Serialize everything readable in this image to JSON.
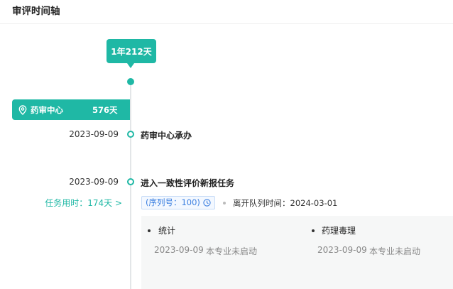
{
  "header": {
    "title": "审评时间轴"
  },
  "timeline": {
    "total_duration": "1年212天",
    "center": {
      "name": "药审中心",
      "days": "576天",
      "icon": "location-pin-icon"
    },
    "events": [
      {
        "date": "2023-09-09",
        "title": "药审中心承办"
      },
      {
        "date": "2023-09-09",
        "title": "进入一致性评价新报任务"
      }
    ],
    "task": {
      "time_used": "任务用时：174天 >",
      "sequence": "(序列号：100)",
      "leave_queue": "离开队列时间：2024-03-01"
    },
    "specialties": [
      {
        "name": "统计",
        "date": "2023-09-09",
        "status": "本专业未启动"
      },
      {
        "name": "药理毒理",
        "date": "2023-09-09",
        "status": "本专业未启动"
      }
    ]
  },
  "colors": {
    "accent": "#1fb8a5",
    "sequence": "#3b7fe0",
    "muted": "#888888"
  }
}
